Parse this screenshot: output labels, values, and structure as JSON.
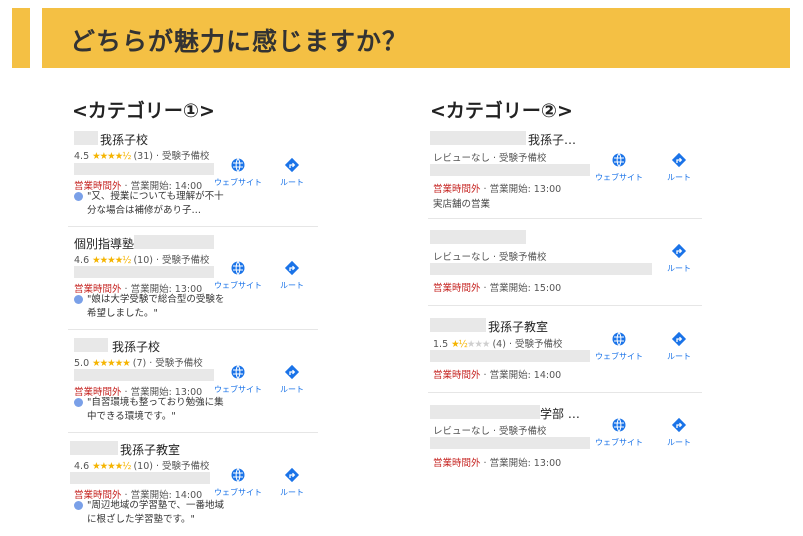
{
  "header": {
    "title": "どちらが魅力に感じますか？"
  },
  "colors": {
    "accent": "#f4c044",
    "closed_red": "#c5221f",
    "link_blue": "#1a73e8",
    "star": "#f5b400"
  },
  "icons": {
    "website": "globe-icon",
    "route": "directions-icon"
  },
  "actions": {
    "website": "ウェブサイト",
    "route": "ルート"
  },
  "category1": {
    "title": "<カテゴリー①>",
    "items": [
      {
        "name": "我孫子校",
        "rating": "4.5",
        "stars": 4.5,
        "count": "(31)",
        "type": "· 受験予備校",
        "status": "営業時間外",
        "hours": "· 営業開始: 14:00",
        "review": "\"又、授業についても理解が不十分な場合は補修があり子…"
      },
      {
        "name": "個別指導塾",
        "rating": "4.6",
        "stars": 4.5,
        "count": "(10)",
        "type": "· 受験予備校",
        "status": "営業時間外",
        "hours": "· 営業開始: 13:00",
        "review": "\"娘は大学受験で総合型の受験を希望しました。\""
      },
      {
        "name": "我孫子校",
        "rating": "5.0",
        "stars": 5,
        "count": "(7)",
        "type": "· 受験予備校",
        "status": "営業時間外",
        "hours": "· 営業開始: 13:00",
        "review": "\"自習環境も整っており勉強に集中できる環境です。\""
      },
      {
        "name": "我孫子教室",
        "rating": "4.6",
        "stars": 4.5,
        "count": "(10)",
        "type": "· 受験予備校",
        "status": "営業時間外",
        "hours": "· 営業開始: 14:00",
        "review": "\"周辺地域の学習塾で、一番地域に根ざした学習塾です。\""
      }
    ]
  },
  "category2": {
    "title": "<カテゴリー②>",
    "items": [
      {
        "name": "我孫子…",
        "meta": "レビューなし · 受験予備校",
        "status": "営業時間外",
        "hours": "· 営業開始: 13:00",
        "note": "実店舗の営業"
      },
      {
        "name": "",
        "meta": "レビューなし · 受験予備校",
        "status": "営業時間外",
        "hours": "· 営業開始: 15:00"
      },
      {
        "name": "我孫子教室",
        "rating": "1.5",
        "stars": 1.5,
        "count": "(4)",
        "type": "· 受験予備校",
        "status": "営業時間外",
        "hours": "· 営業開始: 14:00"
      },
      {
        "name": "学部 …",
        "meta": "レビューなし · 受験予備校",
        "status": "営業時間外",
        "hours": "· 営業開始: 13:00"
      }
    ]
  }
}
